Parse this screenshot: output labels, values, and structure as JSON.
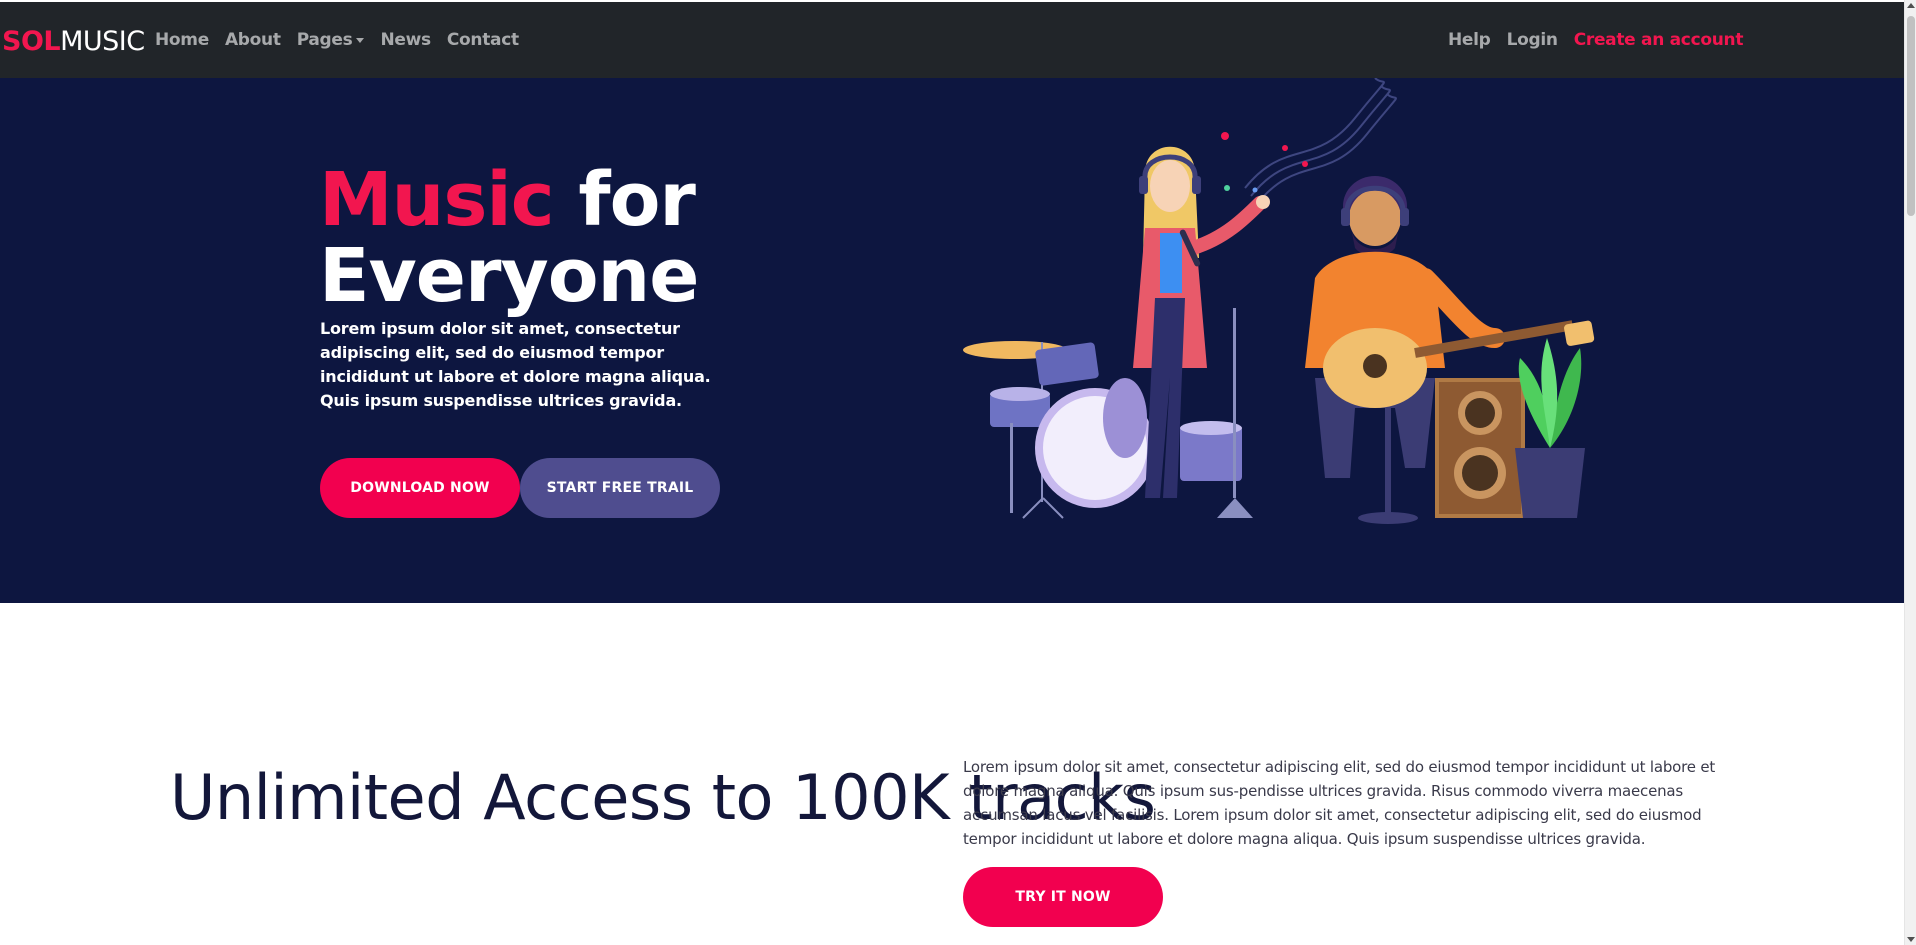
{
  "nav": {
    "logo_sol": "SOL",
    "logo_music": "MUSIC",
    "left_items": [
      "Home",
      "About",
      "Pages",
      "News",
      "Contact"
    ],
    "right_items": [
      "Help",
      "Login",
      "Create an account"
    ]
  },
  "hero": {
    "title_accent": "Music",
    "title_rest_1": " for",
    "title_rest_2": "Everyone",
    "description": "Lorem ipsum dolor sit amet, consectetur adipiscing elit, sed do eiusmod tempor incididunt ut labore et dolore magna aliqua. Quis ipsum suspendisse ultrices gravida.",
    "download_label": "DOWNLOAD NOW",
    "trial_label": "START FREE TRAIL"
  },
  "section2": {
    "title": "Unlimited Access to 100K tracks",
    "text": "Lorem ipsum dolor sit amet, consectetur adipiscing elit, sed do eiusmod tempor incididunt ut labore et dolore magna aliqua. Quis ipsum sus-pendisse ultrices gravida. Risus commodo viverra maecenas accumsan lacus vel facilisis. Lorem ipsum dolor sit amet, consectetur adipiscing elit, sed do eiusmod tempor incididunt ut labore et dolore magna aliqua. Quis ipsum suspendisse ultrices gravida.",
    "try_label": "TRY IT NOW"
  },
  "colors": {
    "accent": "#f2164f",
    "navbar_bg": "#212529",
    "hero_bg": "#0d1640",
    "secondary_button": "#4f4d8f",
    "heading_dark": "#13173a"
  },
  "icons": [
    "chevron-down-icon",
    "music-band-illustration"
  ]
}
